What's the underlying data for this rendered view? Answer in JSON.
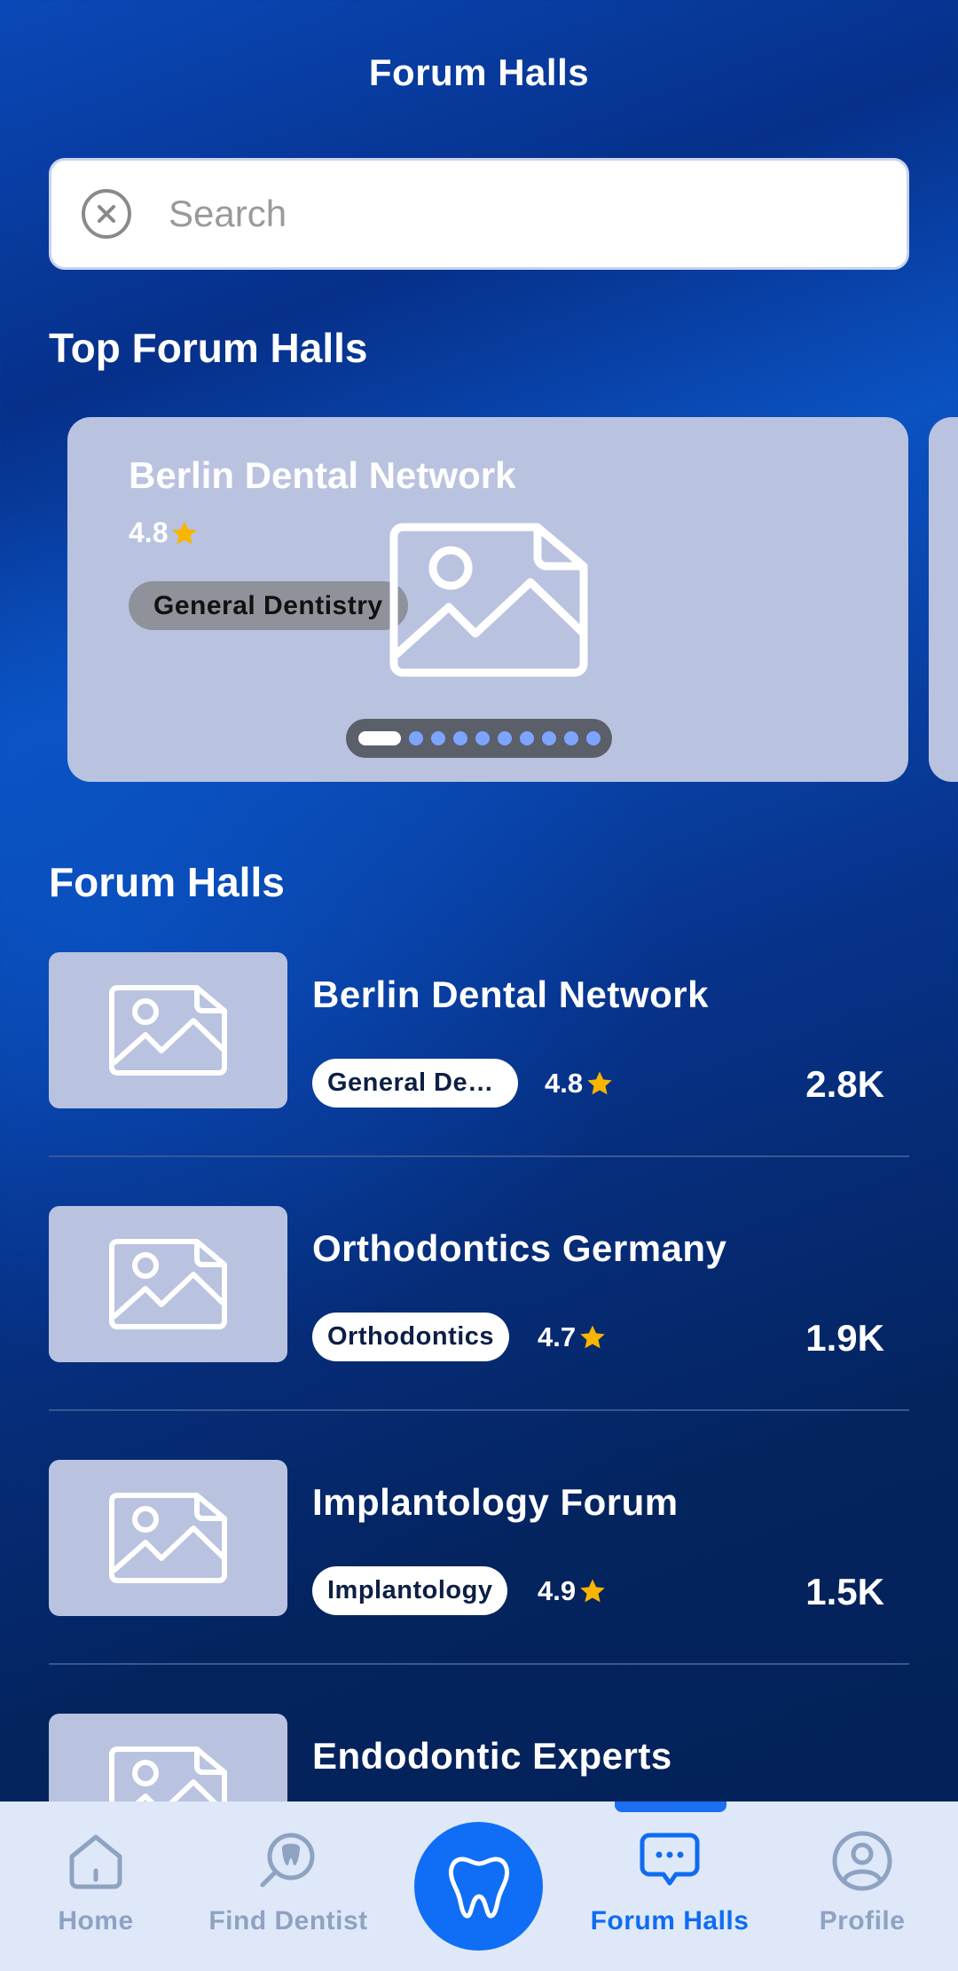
{
  "header": {
    "title": "Forum Halls"
  },
  "search": {
    "placeholder": "Search",
    "value": ""
  },
  "top_section": {
    "title": "Top Forum Halls",
    "carousel": {
      "card": {
        "name": "Berlin Dental Network",
        "rating": "4.8",
        "tag": "General Dentistry"
      },
      "page_count": 10,
      "active_index": 0
    }
  },
  "list_section": {
    "title": "Forum Halls",
    "halls": [
      {
        "name": "Berlin Dental Network",
        "tag": "General De…",
        "rating": "4.8",
        "count": "2.8K"
      },
      {
        "name": "Orthodontics Germany",
        "tag": "Orthodontics",
        "rating": "4.7",
        "count": "1.9K"
      },
      {
        "name": "Implantology Forum",
        "tag": "Implantology",
        "rating": "4.9",
        "count": "1.5K"
      },
      {
        "name": "Endodontic Experts"
      }
    ]
  },
  "bottom_nav": {
    "items": [
      {
        "label": "Home",
        "icon": "home-icon"
      },
      {
        "label": "Find Dentist",
        "icon": "find-dentist-icon"
      },
      {
        "label": "",
        "icon": "tooth-icon"
      },
      {
        "label": "Forum Halls",
        "icon": "chat-bubble-icon",
        "active": true
      },
      {
        "label": "Profile",
        "icon": "profile-icon"
      }
    ]
  },
  "colors": {
    "accent": "#0f6ef5",
    "star": "#f7b500",
    "card_bg": "#b9c3e0",
    "nav_bg": "#dfe8f9"
  }
}
